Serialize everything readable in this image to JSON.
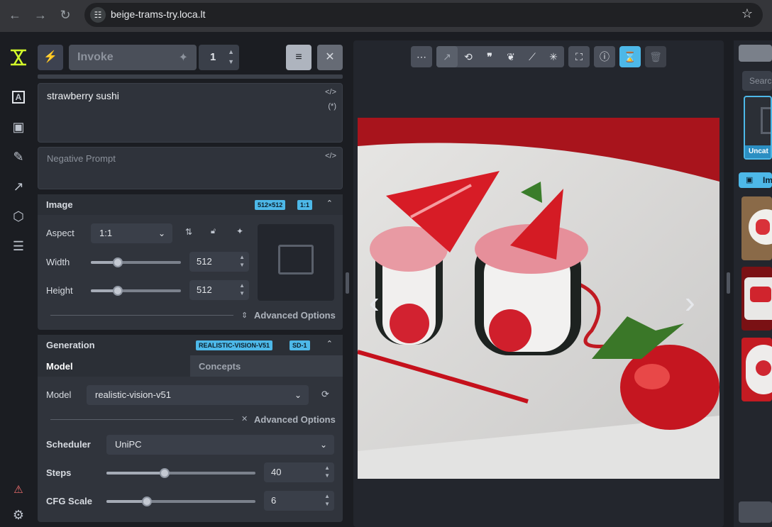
{
  "browser": {
    "url": "beige-trams-try.loca.lt"
  },
  "app": {
    "rail_icons": [
      "text-icon",
      "image-icon",
      "brush-icon",
      "workflow-icon",
      "cube-icon",
      "queue-icon",
      "warning-icon",
      "settings-icon"
    ],
    "invoke_label": "Invoke",
    "iterations": "1",
    "prompt": "strawberry sushi",
    "negative_prompt_placeholder": "Negative Prompt",
    "image_section": {
      "title": "Image",
      "badges": [
        "512×512",
        "1:1"
      ],
      "aspect_label": "Aspect",
      "aspect_value": "1:1",
      "width_label": "Width",
      "width_value": "512",
      "width_fraction": 0.3,
      "height_label": "Height",
      "height_value": "512",
      "height_fraction": 0.3,
      "advanced_label": "Advanced Options"
    },
    "generation_section": {
      "title": "Generation",
      "badges": [
        "REALISTIC-VISION-V51",
        "SD-1"
      ],
      "tab_model": "Model",
      "tab_concepts": "Concepts",
      "model_label": "Model",
      "model_value": "realistic-vision-v51",
      "advanced_label": "Advanced Options",
      "scheduler_label": "Scheduler",
      "scheduler_value": "UniPC",
      "steps_label": "Steps",
      "steps_value": "40",
      "steps_fraction": 0.39,
      "cfg_label": "CFG Scale",
      "cfg_value": "6",
      "cfg_fraction": 0.27
    },
    "right_panel": {
      "search_placeholder": "Search",
      "board_label": "Uncat",
      "images_label": "Im"
    },
    "colors": {
      "accent": "#4db8e8",
      "logo": "#d4ff2a",
      "warning": "#f87171"
    }
  }
}
